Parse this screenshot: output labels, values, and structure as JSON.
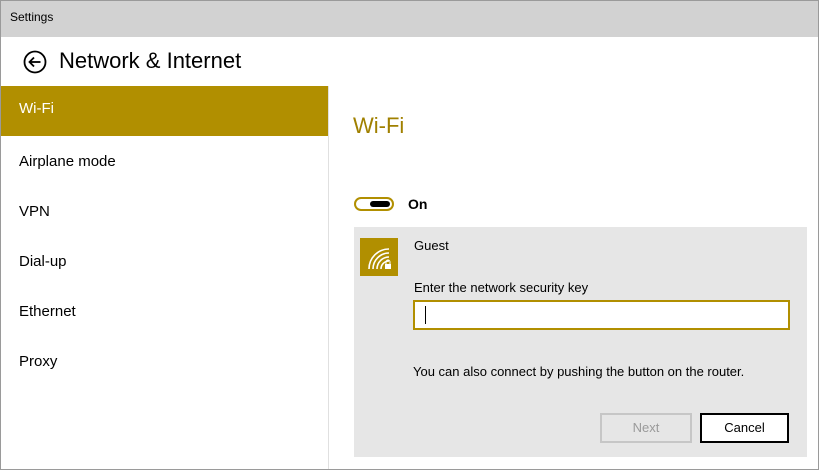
{
  "window": {
    "title": "Settings"
  },
  "header": {
    "title": "Network & Internet",
    "back_icon": "back-arrow-icon"
  },
  "sidebar": {
    "items": [
      {
        "label": "Wi-Fi",
        "active": true
      },
      {
        "label": "Airplane mode",
        "active": false
      },
      {
        "label": "VPN",
        "active": false
      },
      {
        "label": "Dial-up",
        "active": false
      },
      {
        "label": "Ethernet",
        "active": false
      },
      {
        "label": "Proxy",
        "active": false
      }
    ]
  },
  "main": {
    "title": "Wi-Fi",
    "toggle": {
      "state": "On"
    },
    "network": {
      "name": "Guest",
      "icon": "wifi-secured-icon",
      "key_label": "Enter the network security key",
      "key_value": "",
      "router_hint": "You can also connect by pushing the button on the router.",
      "next_label": "Next",
      "cancel_label": "Cancel"
    }
  },
  "colors": {
    "accent": "#b18f00",
    "title_accent": "#a08000",
    "titlebar": "#d2d2d2",
    "panel": "#e6e6e6"
  }
}
